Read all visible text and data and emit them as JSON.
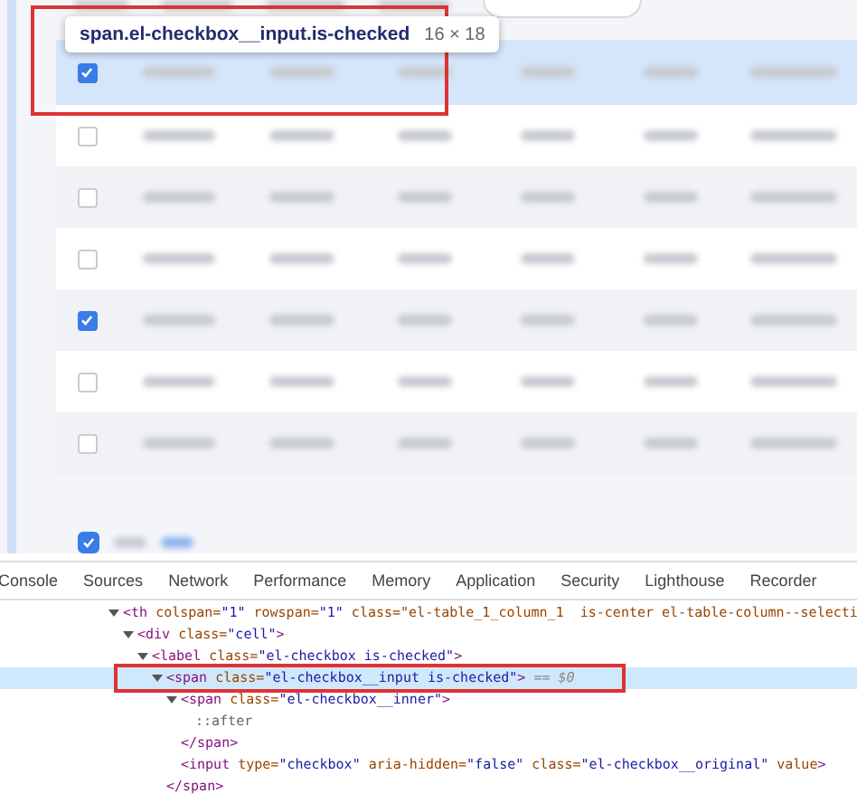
{
  "inspector_tooltip": {
    "selector": "span.el-checkbox__input.is-checked",
    "size": "16 × 18"
  },
  "table": {
    "header": {
      "checked": true
    },
    "rows": [
      {
        "checked": false
      },
      {
        "checked": false
      },
      {
        "checked": false
      },
      {
        "checked": true
      },
      {
        "checked": false
      },
      {
        "checked": false
      }
    ]
  },
  "footer": {
    "select_all": {
      "checked": true
    }
  },
  "devtools": {
    "tabs": [
      {
        "label": "Console",
        "selected": false
      },
      {
        "label": "Sources",
        "selected": false
      },
      {
        "label": "Network",
        "selected": false
      },
      {
        "label": "Performance",
        "selected": false
      },
      {
        "label": "Memory",
        "selected": false
      },
      {
        "label": "Application",
        "selected": false
      },
      {
        "label": "Security",
        "selected": false
      },
      {
        "label": "Lighthouse",
        "selected": false
      },
      {
        "label": "Recorder",
        "selected": false
      }
    ],
    "dom": [
      {
        "text": "<th colspan=\"1\" rowspan=\"1\" class=\"el-table_1_column_1  is-center el-table-column--selecti",
        "expanded": true,
        "selected": false,
        "children": [
          {
            "text": "<div class=\"cell\">",
            "expanded": true,
            "selected": false,
            "children": [
              {
                "text": "<label class=\"el-checkbox is-checked\">",
                "expanded": true,
                "selected": false,
                "children": [
                  {
                    "text": "<span class=\"el-checkbox__input is-checked\">",
                    "suffix": "== $0",
                    "expanded": true,
                    "selected": true,
                    "closing": "</span>",
                    "children": [
                      {
                        "text": "<span class=\"el-checkbox__inner\">",
                        "expanded": true,
                        "selected": false,
                        "closing": "</span>",
                        "children": [
                          {
                            "text": "::after",
                            "selected": false
                          }
                        ]
                      },
                      {
                        "text": "<input type=\"checkbox\" aria-hidden=\"false\" class=\"el-checkbox__original\" value>",
                        "selected": false
                      }
                    ]
                  }
                ]
              }
            ]
          }
        ]
      }
    ]
  }
}
